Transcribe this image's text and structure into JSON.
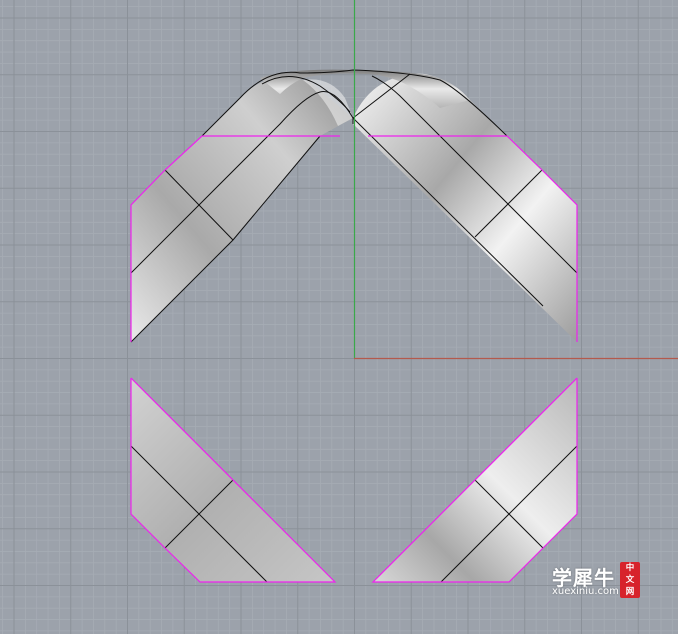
{
  "viewport": {
    "view": "Top",
    "background_color": "#9ca2ab",
    "grid": {
      "visible": true,
      "minor_color": "#a6acb4",
      "major_color": "#8b9199"
    },
    "axes": {
      "x_axis_color": "#b35a4d",
      "y_axis_color": "#3aa84a"
    },
    "selection_edge_color": "#ee22ee",
    "surface_color": "#c8c8c8"
  },
  "watermark": {
    "title": "学犀牛",
    "domain": "xuexiniu.com",
    "seal_chars": [
      "中",
      "文",
      "网"
    ],
    "seal_color": "#d7232b"
  }
}
